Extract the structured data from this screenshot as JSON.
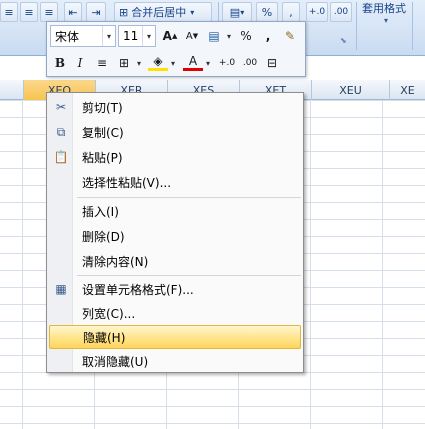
{
  "ribbon": {
    "merge_center_label": "合并后居中",
    "percent_label": "%",
    "comma_label": ",",
    "dec_inc_label": "+.0",
    "dec_dec_label": ".00",
    "table_format_label": "套用格式"
  },
  "mini_toolbar": {
    "font_name": "宋体",
    "font_size": "11",
    "grow_font": "A",
    "shrink_font": "A",
    "percent": "%",
    "comma": ",",
    "bold": "B",
    "italic": "I",
    "font_color_glyph": "A",
    "dec_inc": "+.0",
    "dec_dec": ".00"
  },
  "sheet": {
    "columns": [
      "XEQ",
      "XER",
      "XES",
      "XET",
      "XEU",
      "XE"
    ],
    "selected_column": "XEQ"
  },
  "context_menu": {
    "items": [
      {
        "label": "剪切(T)",
        "icon": "cut-icon"
      },
      {
        "label": "复制(C)",
        "icon": "copy-icon"
      },
      {
        "label": "粘贴(P)",
        "icon": "paste-icon"
      },
      {
        "label": "选择性粘贴(V)...",
        "icon": ""
      },
      {
        "label": "插入(I)",
        "icon": ""
      },
      {
        "label": "删除(D)",
        "icon": ""
      },
      {
        "label": "清除内容(N)",
        "icon": ""
      },
      {
        "label": "设置单元格格式(F)...",
        "icon": "format-cells-icon"
      },
      {
        "label": "列宽(C)...",
        "icon": ""
      },
      {
        "label": "隐藏(H)",
        "icon": ""
      },
      {
        "label": "取消隐藏(U)",
        "icon": ""
      }
    ],
    "highlighted": "隐藏(H)"
  },
  "colors": {
    "ribbon_bg": "#d6e4f5",
    "selection_highlight": "#ffd45e",
    "selected_column_header": "#f8c44f"
  }
}
